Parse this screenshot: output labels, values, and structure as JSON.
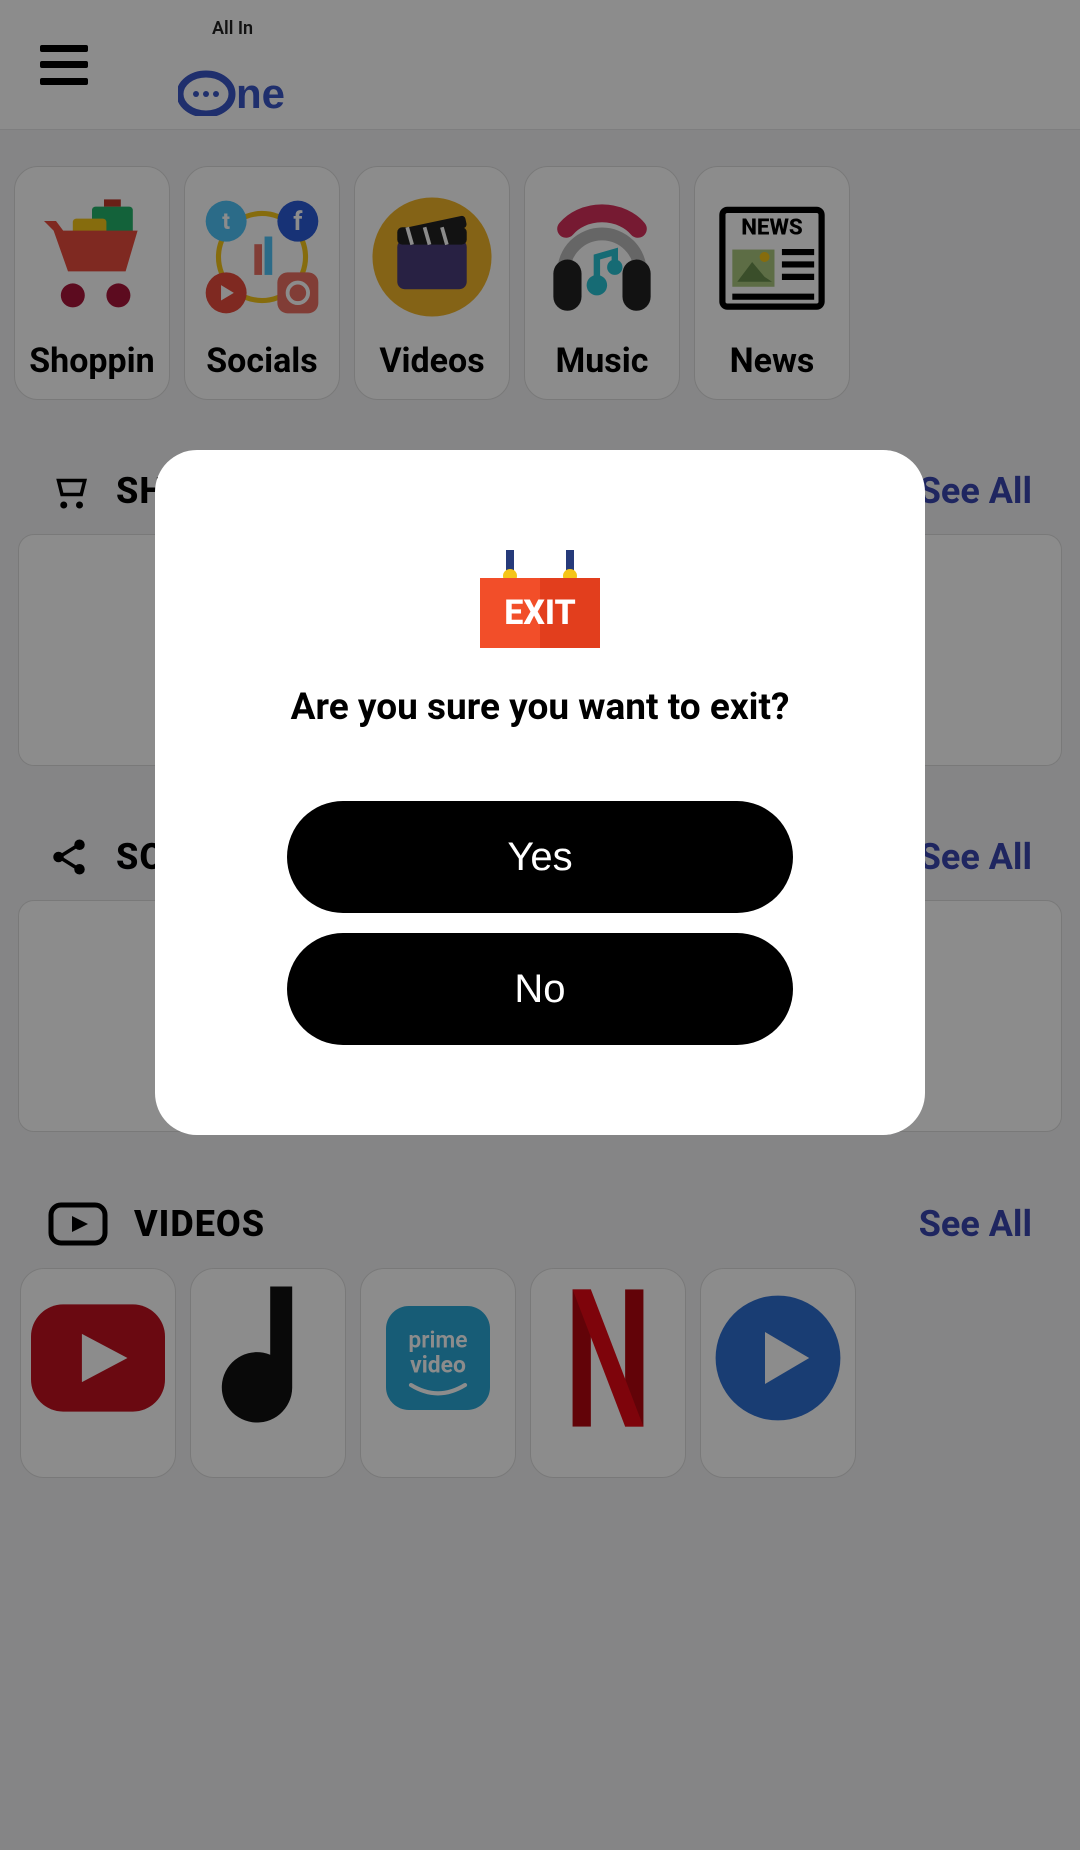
{
  "app": {
    "logo_allin": "All In",
    "logo_rest": "ne"
  },
  "categories": [
    {
      "label": "Shoppin"
    },
    {
      "label": "Socials"
    },
    {
      "label": "Videos"
    },
    {
      "label": "Music"
    },
    {
      "label": "News"
    }
  ],
  "sections": {
    "shopping": {
      "title": "SHOPPING",
      "see_all": "See All"
    },
    "socials": {
      "title": "SOCIALS",
      "see_all": "See All"
    },
    "videos": {
      "title": "VIDEOS",
      "see_all": "See All"
    }
  },
  "video_tiles": [
    {
      "name": "youtube"
    },
    {
      "name": "dailymotion"
    },
    {
      "name": "prime-video",
      "line1": "prime",
      "line2": "video"
    },
    {
      "name": "netflix"
    },
    {
      "name": "mxplayer"
    }
  ],
  "dialog": {
    "exit_label": "EXIT",
    "message": "Are you sure you want to exit?",
    "yes": "Yes",
    "no": "No"
  }
}
